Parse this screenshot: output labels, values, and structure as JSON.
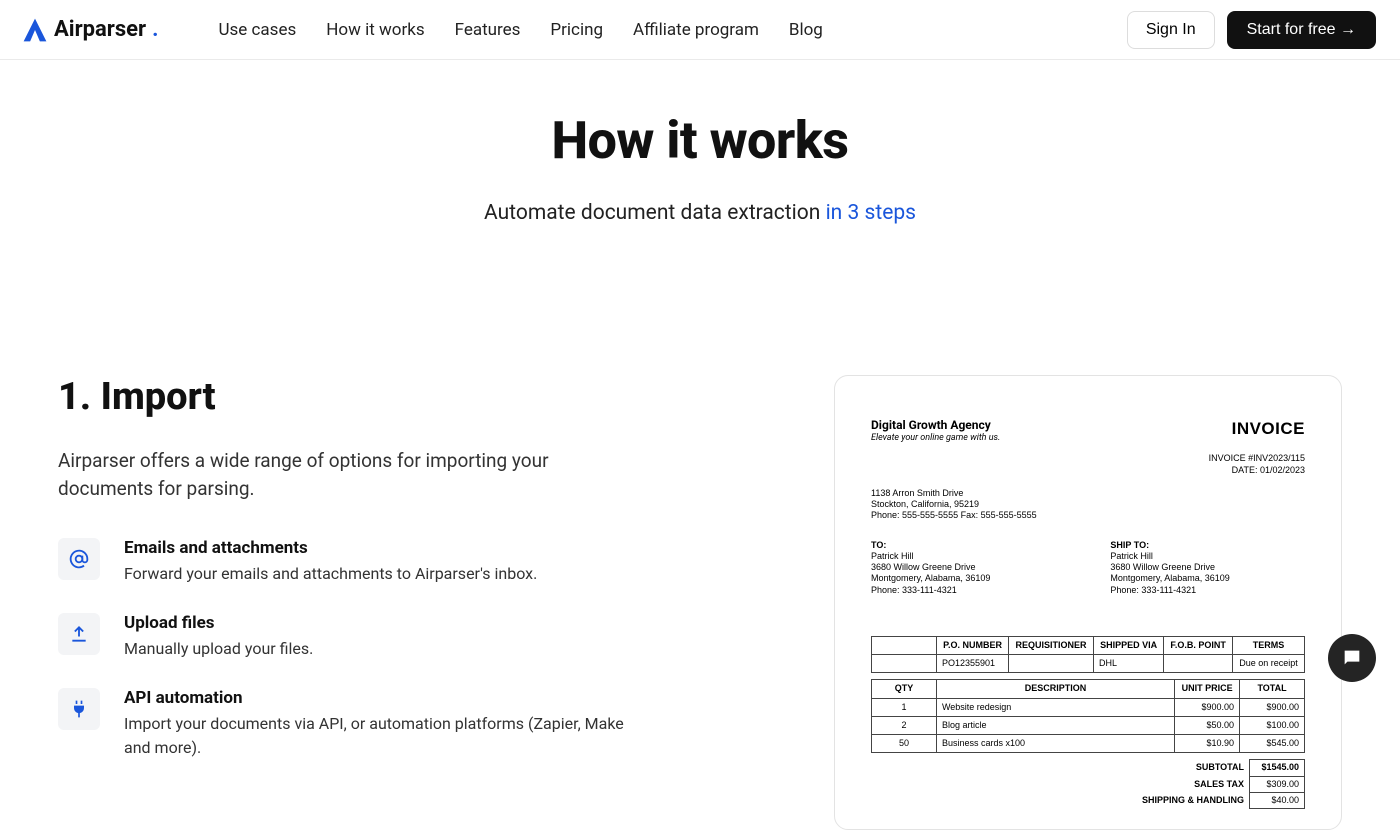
{
  "brand": {
    "name": "Airparser",
    "dot": "."
  },
  "nav": {
    "usecases": "Use cases",
    "how": "How it works",
    "features": "Features",
    "pricing": "Pricing",
    "affiliate": "Affiliate program",
    "blog": "Blog"
  },
  "actions": {
    "signin": "Sign In",
    "start": "Start for free →"
  },
  "hero": {
    "title": "How it works",
    "subtitle_prefix": "Automate document data extraction ",
    "subtitle_accent": "in 3 steps"
  },
  "section": {
    "heading": "1. Import",
    "intro": "Airparser offers a wide range of options for importing your documents for parsing.",
    "feats": {
      "emails": {
        "title": "Emails and attachments",
        "desc": "Forward your emails and attachments to Airparser's inbox."
      },
      "upload": {
        "title": "Upload files",
        "desc": "Manually upload your files."
      },
      "api": {
        "title": "API automation",
        "desc": "Import your documents via API, or automation platforms (Zapier, Make and more)."
      }
    }
  },
  "invoice": {
    "company": {
      "name": "Digital Growth Agency",
      "tagline": "Elevate your online game with us."
    },
    "label": "INVOICE",
    "meta": {
      "number_line": "INVOICE #INV2023/115",
      "date_line": "DATE: 01/02/2023"
    },
    "company_address": {
      "l1": "1138 Arron Smith Drive",
      "l2": "Stockton, California, 95219",
      "l3": "Phone: 555-555-5555 Fax: 555-555-5555"
    },
    "to": {
      "label": "TO:",
      "name": "Patrick Hill",
      "l1": "3680 Willow Greene Drive",
      "l2": "Montgomery, Alabama, 36109",
      "l3": "Phone: 333-111-4321"
    },
    "ship": {
      "label": "SHIP TO:",
      "name": "Patrick Hill",
      "l1": "3680 Willow Greene Drive",
      "l2": "Montgomery, Alabama, 36109",
      "l3": "Phone: 333-111-4321"
    },
    "t1_head": {
      "po": "P.O. NUMBER",
      "req": "REQUISITIONER",
      "via": "SHIPPED VIA",
      "fob": "F.O.B. POINT",
      "terms": "TERMS"
    },
    "t1_row": {
      "po": "PO12355901",
      "req": "",
      "via": "DHL",
      "fob": "",
      "terms": "Due on receipt"
    },
    "t2_head": {
      "qty": "QTY",
      "desc": "DESCRIPTION",
      "unit": "UNIT PRICE",
      "total": "TOTAL"
    },
    "t2_rows": {
      "r0": {
        "qty": "1",
        "desc": "Website redesign",
        "unit": "$900.00",
        "total": "$900.00"
      },
      "r1": {
        "qty": "2",
        "desc": "Blog article",
        "unit": "$50.00",
        "total": "$100.00"
      },
      "r2": {
        "qty": "50",
        "desc": "Business cards x100",
        "unit": "$10.90",
        "total": "$545.00"
      }
    },
    "totals": {
      "subtotal_l": "SUBTOTAL",
      "subtotal_v": "$1545.00",
      "tax_l": "SALES TAX",
      "tax_v": "$309.00",
      "ship_l": "SHIPPING & HANDLING",
      "ship_v": "$40.00"
    }
  }
}
